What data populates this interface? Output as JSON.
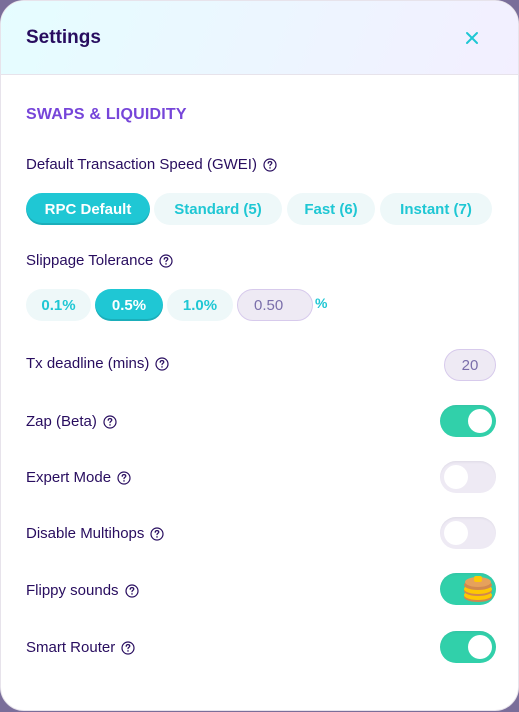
{
  "modal": {
    "title": "Settings"
  },
  "section": {
    "title": "SWAPS & LIQUIDITY"
  },
  "gas": {
    "label": "Default Transaction Speed (GWEI)",
    "options": [
      "RPC Default",
      "Standard (5)",
      "Fast (6)",
      "Instant (7)"
    ],
    "selected": "RPC Default"
  },
  "slippage": {
    "label": "Slippage Tolerance",
    "options": [
      "0.1%",
      "0.5%",
      "1.0%"
    ],
    "selected": "0.5%",
    "custom_value": "0.50",
    "unit": "%"
  },
  "deadline": {
    "label": "Tx deadline (mins)",
    "value": "20"
  },
  "toggles": {
    "zap": {
      "label": "Zap (Beta)",
      "on": true
    },
    "expert": {
      "label": "Expert Mode",
      "on": false
    },
    "multihops": {
      "label": "Disable Multihops",
      "on": false
    },
    "sounds": {
      "label": "Flippy sounds",
      "on": true
    },
    "router": {
      "label": "Smart Router",
      "on": true
    }
  },
  "colors": {
    "primary": "#1fc7d4",
    "success": "#31d0aa",
    "secondary": "#7645d9",
    "text": "#280d5f"
  },
  "icons": {
    "close": "close-icon",
    "help": "help-circle-icon",
    "pancake": "pancake-icon"
  }
}
